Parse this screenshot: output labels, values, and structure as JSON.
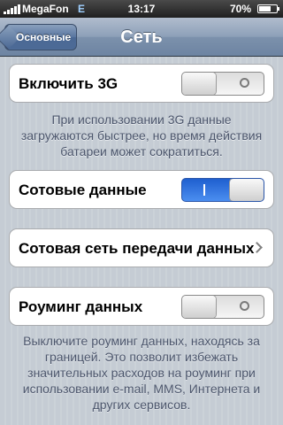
{
  "statusbar": {
    "carrier": "MegaFon",
    "network": "E",
    "time": "13:17",
    "battery": "70%",
    "battery_level": 0.7
  },
  "navbar": {
    "title": "Сеть",
    "back_label": "Основные"
  },
  "cells": {
    "enable_3g": {
      "label": "Включить 3G",
      "state": "off"
    },
    "enable_3g_note": "При использовании 3G данные загружаются быстрее, но время действия батареи может сократиться.",
    "cellular_data": {
      "label": "Сотовые данные",
      "state": "on"
    },
    "cellular_network": {
      "label": "Сотовая сеть передачи данных"
    },
    "data_roaming": {
      "label": "Роуминг данных",
      "state": "off"
    },
    "roaming_note": "Выключите роуминг данных, находясь за границей. Это позволит избежать значительных расходов на роуминг при использовании e-mail, MMS, Интернета и других сервисов."
  },
  "icons": {
    "signal": "signal-bars-icon",
    "battery": "battery-icon",
    "back": "back-chevron-icon",
    "disclosure": "chevron-right-icon"
  }
}
